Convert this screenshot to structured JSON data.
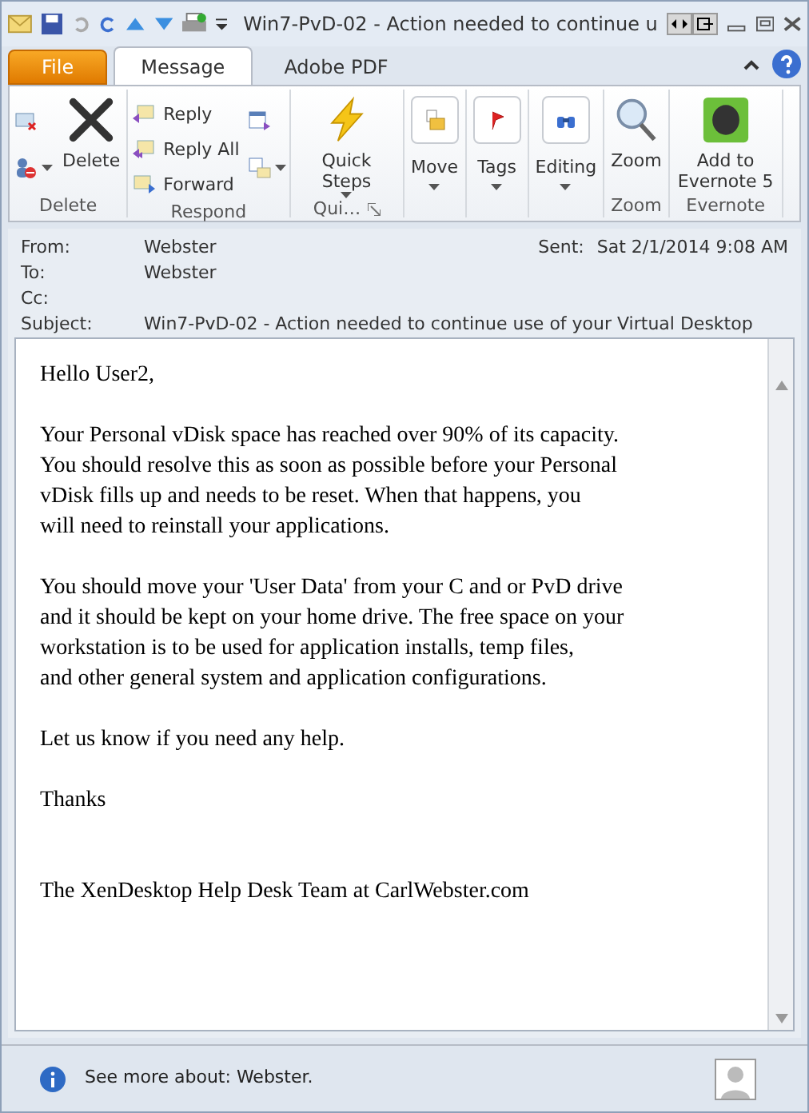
{
  "window": {
    "title": "Win7-PvD-02 - Action needed to continue u"
  },
  "tabs": [
    {
      "label": "File",
      "kind": "file",
      "selected": false
    },
    {
      "label": "Message",
      "kind": "tab",
      "selected": true
    },
    {
      "label": "Adobe PDF",
      "kind": "tab",
      "selected": false
    }
  ],
  "ribbon": {
    "groups": [
      {
        "label": "Delete",
        "buttons": [
          {
            "kind": "icononly",
            "dropdown": false
          },
          {
            "kind": "icononly",
            "dropdown": true
          },
          {
            "kind": "large",
            "label": "Delete",
            "dropdown": false
          }
        ]
      },
      {
        "label": "Respond",
        "buttons": [
          {
            "kind": "small",
            "label": "Reply"
          },
          {
            "kind": "small",
            "label": "Reply All"
          },
          {
            "kind": "small",
            "label": "Forward"
          },
          {
            "kind": "icononly",
            "dropdown": false
          },
          {
            "kind": "icononly",
            "dropdown": true
          }
        ]
      },
      {
        "label": "Qui…",
        "launcher": true,
        "buttons": [
          {
            "kind": "large",
            "label": "Quick Steps",
            "dropdown": true
          }
        ]
      },
      {
        "buttons": [
          {
            "kind": "boxed",
            "label": "Move",
            "dropdown": true
          }
        ]
      },
      {
        "buttons": [
          {
            "kind": "boxed",
            "label": "Tags",
            "dropdown": true
          }
        ]
      },
      {
        "buttons": [
          {
            "kind": "boxed",
            "label": "Editing",
            "dropdown": true
          }
        ]
      },
      {
        "label": "Zoom",
        "buttons": [
          {
            "kind": "large",
            "label": "Zoom",
            "dropdown": false
          }
        ]
      },
      {
        "label": "Evernote",
        "buttons": [
          {
            "kind": "large",
            "label": "Add to Evernote 5",
            "dropdown": false
          }
        ]
      }
    ]
  },
  "header": {
    "fields": [
      {
        "label": "From:",
        "value": "Webster"
      },
      {
        "label": "To:",
        "value": "Webster"
      },
      {
        "label": "Cc:"
      },
      {
        "label": "Subject:",
        "value": "Win7-PvD-02 - Action needed to continue use of your Virtual Desktop"
      }
    ],
    "sent_label": "Sent:",
    "sent_value": "Sat 2/1/2014 9:08 AM"
  },
  "body": {
    "paragraphs": [
      {
        "kind": "text",
        "lines": [
          "Hello User2,"
        ]
      },
      {
        "kind": "text",
        "lines": [
          "Your Personal vDisk space has reached over 90% of its capacity.",
          "You should resolve this as soon as possible before your Personal",
          "vDisk fills up and needs to be reset. When that happens, you",
          "will need to reinstall your applications."
        ]
      },
      {
        "kind": "text",
        "lines": [
          "You should move your 'User Data' from your C and or PvD drive",
          "and it should be kept on your home drive. The free space on your",
          "workstation is to be used for application installs, temp files,",
          "and other general system and application configurations."
        ]
      },
      {
        "kind": "text",
        "lines": [
          "Let us know if you need any help."
        ]
      },
      {
        "kind": "text",
        "lines": [
          "Thanks"
        ]
      },
      {
        "kind": "signature",
        "lines": [
          "The XenDesktop Help Desk Team at CarlWebster.com"
        ]
      }
    ]
  },
  "footer": {
    "text": "See more about: Webster."
  }
}
